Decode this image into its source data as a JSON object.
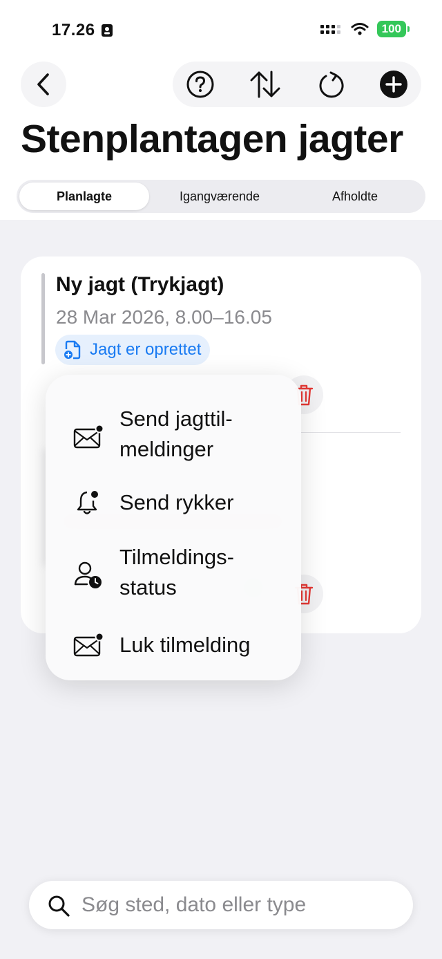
{
  "status_bar": {
    "time": "17.26",
    "battery": "100"
  },
  "header": {
    "title": "Stenplantagen jagter",
    "icons": {
      "back": "chevron-left-icon",
      "help": "question-circle-icon",
      "sort": "sort-arrows-icon",
      "refresh": "refresh-icon",
      "add": "plus-circle-icon"
    }
  },
  "tabs": [
    {
      "label": "Planlagte",
      "active": true
    },
    {
      "label": "Igangværende",
      "active": false
    },
    {
      "label": "Afholdte",
      "active": false
    }
  ],
  "event_card": {
    "title": "Ny jagt (Trykjagt)",
    "date": "28 Mar 2026, 8.00–16.05",
    "status_tag": "Jagt er oprettet",
    "tag_color": "#1a7bf2",
    "delete_color": "#e53935"
  },
  "context_menu": {
    "items": [
      {
        "label": "Send jagttil-\nmeldinger",
        "icon": "envelope-badge-icon"
      },
      {
        "label": "Send rykker",
        "icon": "bell-badge-icon"
      },
      {
        "label": "Tilmeldings-\nstatus",
        "icon": "person-clock-icon"
      },
      {
        "label": "Luk tilmelding",
        "icon": "envelope-badge-icon"
      }
    ]
  },
  "search": {
    "placeholder": "Søg sted, dato eller type"
  }
}
